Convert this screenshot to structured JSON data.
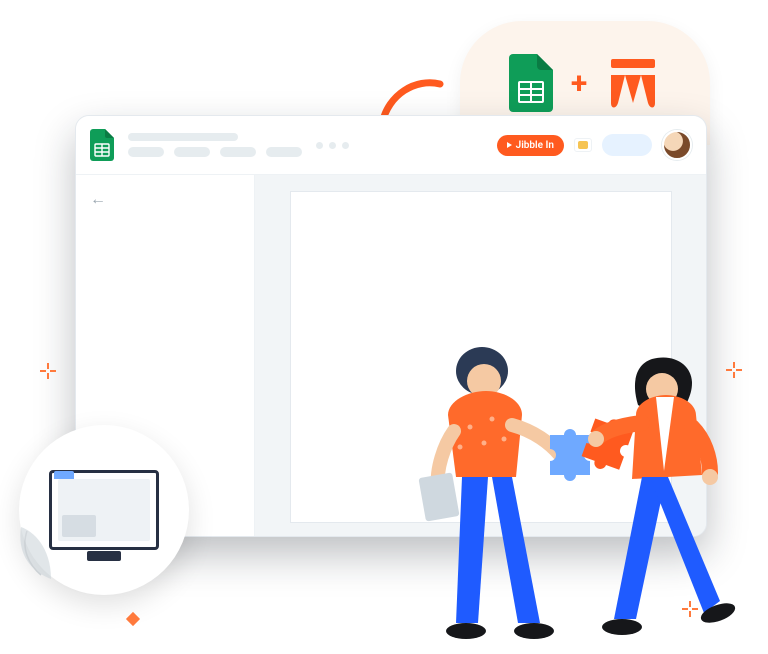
{
  "integration": {
    "service_a": "Google Sheets",
    "service_b": "Jibble",
    "plus": "+"
  },
  "app": {
    "topbar": {
      "jibble_button_label": "Jibble In"
    },
    "sidepanel": {
      "back_glyph": "←"
    }
  },
  "decor": {
    "monitor_label": "desktop-monitor",
    "people_label": "collaboration-illustration"
  }
}
